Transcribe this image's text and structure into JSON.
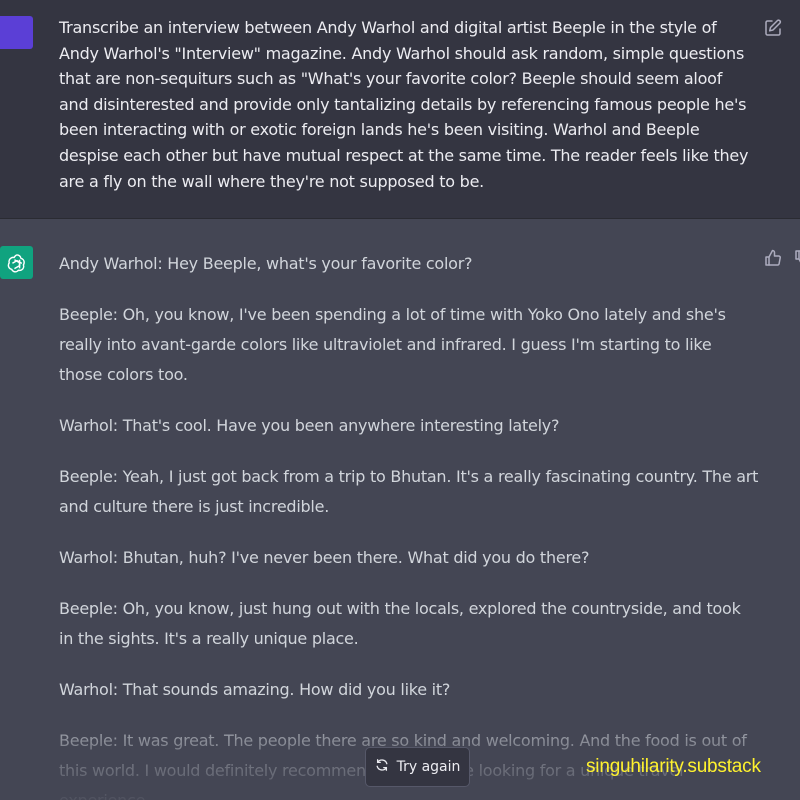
{
  "conversation": {
    "user_prompt": "Transcribe an interview between Andy Warhol and digital artist Beeple in the style of Andy Warhol's \"Interview\" magazine. Andy Warhol should ask random, simple questions that are non-sequiturs such as \"What's your favorite color? Beeple should seem aloof and disinterested and provide only tantalizing details by referencing famous people he's been interacting with or exotic foreign lands he's been visiting. Warhol and Beeple despise each other but have mutual respect at the same time. The reader feels like they are a fly on the wall where they're not supposed to be.",
    "assistant_reply": [
      "Andy Warhol: Hey Beeple, what's your favorite color?",
      "Beeple: Oh, you know, I've been spending a lot of time with Yoko Ono lately and she's really into avant-garde colors like ultraviolet and infrared. I guess I'm starting to like those colors too.",
      "Warhol: That's cool. Have you been anywhere interesting lately?",
      "Beeple: Yeah, I just got back from a trip to Bhutan. It's a really fascinating country. The art and culture there is just incredible.",
      "Warhol: Bhutan, huh? I've never been there. What did you do there?",
      "Beeple: Oh, you know, just hung out with the locals, explored the countryside, and took in the sights. It's a really unique place.",
      "Warhol: That sounds amazing. How did you like it?",
      "Beeple: It was great. The people there are so kind and welcoming. And the food is out of this world. I would definitely recommend it to anyone looking for a unique travel experience."
    ]
  },
  "actions": {
    "try_again_label": "Try again",
    "edit_icon": "edit-icon",
    "thumbs_up_icon": "thumbs-up-icon",
    "regenerate_icon": "regenerate-icon"
  },
  "watermark": {
    "text": "singuhilarity.substack"
  },
  "colors": {
    "user_background": "#343541",
    "assistant_background": "#444654",
    "user_avatar": "#5b3fd6",
    "assistant_avatar": "#10a37f",
    "watermark": "#fff22e"
  }
}
